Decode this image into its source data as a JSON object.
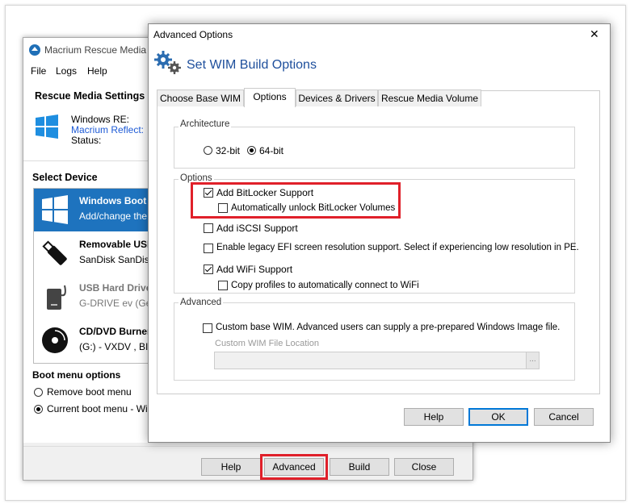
{
  "bg_window": {
    "title": "Macrium Rescue Media C",
    "menu": [
      "File",
      "Logs",
      "Help"
    ],
    "settings_heading": "Rescue Media Settings",
    "winre_label": "Windows RE:",
    "reflect_label": "Macrium Reflect:",
    "status_label": "Status:",
    "select_device_heading": "Select Device",
    "devices": [
      {
        "name": "Windows Boot",
        "sub": "Add/change the",
        "icon": "windows-logo-icon",
        "selected": true
      },
      {
        "name": "Removable USB",
        "sub": "SanDisk SanDisk",
        "icon": "usb-stick-icon",
        "selected": false
      },
      {
        "name": "USB Hard Drive",
        "sub": "G-DRIVE ev (Gen",
        "icon": "external-drive-icon",
        "selected": false
      },
      {
        "name": "CD/DVD Burner",
        "sub": "(G:) - VXDV   , BI",
        "icon": "disc-icon",
        "selected": false
      }
    ],
    "boot_heading": "Boot menu options",
    "boot_options": [
      "Remove boot menu",
      "Current boot menu - Windo"
    ],
    "buttons": {
      "help": "Help",
      "advanced": "Advanced",
      "build": "Build",
      "close": "Close"
    }
  },
  "dialog": {
    "title": "Advanced Options",
    "close_glyph": "✕",
    "heading": "Set WIM Build Options",
    "tabs": [
      "Choose Base WIM",
      "Options",
      "Devices & Drivers",
      "Rescue Media Volume"
    ],
    "active_tab": "Options",
    "architecture": {
      "title": "Architecture",
      "options": [
        "32-bit",
        "64-bit"
      ],
      "selected": "64-bit"
    },
    "options_group": {
      "title": "Options",
      "bitlocker": "Add BitLocker Support",
      "auto_unlock": "Automatically unlock BitLocker Volumes",
      "iscsi": "Add iSCSI Support",
      "legacy_efi": "Enable legacy EFI screen resolution support.  Select if experiencing low resolution in PE.",
      "wifi": "Add WiFi Support",
      "copy_profiles": "Copy profiles to automatically connect to WiFi"
    },
    "advanced_group": {
      "title": "Advanced",
      "custom_wim": "Custom base WIM. Advanced users can supply a pre-prepared Windows Image file.",
      "file_location_label": "Custom WIM File Location",
      "file_location_value": "",
      "browse_label": "..."
    },
    "buttons": {
      "help": "Help",
      "ok": "OK",
      "cancel": "Cancel"
    }
  },
  "colors": {
    "selection": "#1e73be",
    "highlight": "#e0202a",
    "link": "#1e5bd6"
  }
}
